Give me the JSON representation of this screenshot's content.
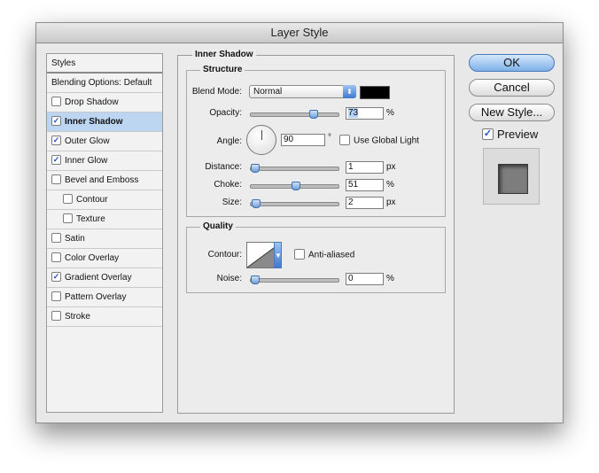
{
  "window": {
    "title": "Layer Style"
  },
  "styles_list": {
    "items": [
      {
        "label": "Styles",
        "checkbox": false,
        "checked": false,
        "selected": false,
        "header": true,
        "indent": false
      },
      {
        "label": "Blending Options: Default",
        "checkbox": false,
        "checked": false,
        "selected": false,
        "header": false,
        "indent": false
      },
      {
        "label": "Drop Shadow",
        "checkbox": true,
        "checked": false,
        "selected": false,
        "header": false,
        "indent": false
      },
      {
        "label": "Inner Shadow",
        "checkbox": true,
        "checked": true,
        "selected": true,
        "header": false,
        "indent": false
      },
      {
        "label": "Outer Glow",
        "checkbox": true,
        "checked": true,
        "selected": false,
        "header": false,
        "indent": false
      },
      {
        "label": "Inner Glow",
        "checkbox": true,
        "checked": true,
        "selected": false,
        "header": false,
        "indent": false
      },
      {
        "label": "Bevel and Emboss",
        "checkbox": true,
        "checked": false,
        "selected": false,
        "header": false,
        "indent": false
      },
      {
        "label": "Contour",
        "checkbox": true,
        "checked": false,
        "selected": false,
        "header": false,
        "indent": true
      },
      {
        "label": "Texture",
        "checkbox": true,
        "checked": false,
        "selected": false,
        "header": false,
        "indent": true
      },
      {
        "label": "Satin",
        "checkbox": true,
        "checked": false,
        "selected": false,
        "header": false,
        "indent": false
      },
      {
        "label": "Color Overlay",
        "checkbox": true,
        "checked": false,
        "selected": false,
        "header": false,
        "indent": false
      },
      {
        "label": "Gradient Overlay",
        "checkbox": true,
        "checked": true,
        "selected": false,
        "header": false,
        "indent": false
      },
      {
        "label": "Pattern Overlay",
        "checkbox": true,
        "checked": false,
        "selected": false,
        "header": false,
        "indent": false
      },
      {
        "label": "Stroke",
        "checkbox": true,
        "checked": false,
        "selected": false,
        "header": false,
        "indent": false
      }
    ]
  },
  "inner_shadow": {
    "title": "Inner Shadow",
    "structure": {
      "title": "Structure",
      "blend_mode_label": "Blend Mode:",
      "blend_mode_value": "Normal",
      "color": "#000000",
      "opacity_label": "Opacity:",
      "opacity_value": "73",
      "opacity_unit": "%",
      "opacity_level": 0.73,
      "angle_label": "Angle:",
      "angle_value": "90",
      "angle_unit": "°",
      "use_global_light_label": "Use Global Light",
      "use_global_light_checked": false,
      "distance_label": "Distance:",
      "distance_value": "1",
      "distance_unit": "px",
      "distance_level": 0.0,
      "choke_label": "Choke:",
      "choke_value": "51",
      "choke_unit": "%",
      "choke_level": 0.51,
      "size_label": "Size:",
      "size_value": "2",
      "size_unit": "px",
      "size_level": 0.01
    },
    "quality": {
      "title": "Quality",
      "contour_label": "Contour:",
      "anti_aliased_label": "Anti-aliased",
      "anti_aliased_checked": false,
      "noise_label": "Noise:",
      "noise_value": "0",
      "noise_unit": "%",
      "noise_level": 0.0
    }
  },
  "buttons": {
    "ok": "OK",
    "cancel": "Cancel",
    "new_style": "New Style..."
  },
  "preview": {
    "label": "Preview",
    "checked": true
  }
}
